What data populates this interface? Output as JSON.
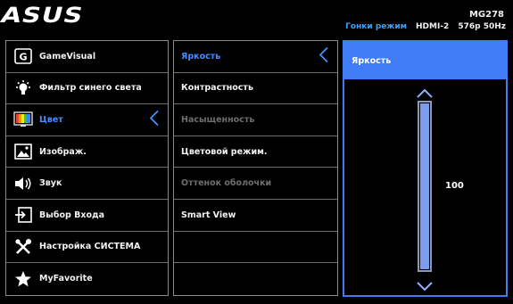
{
  "header": {
    "logo": "ASUS",
    "model": "MG278",
    "mode": "Гонки режим",
    "input": "HDMI-2",
    "resolution": "576p 50Hz"
  },
  "main_menu": [
    {
      "label": "GameVisual",
      "icon": "gamevisual-icon"
    },
    {
      "label": "Фильтр синего света",
      "icon": "bulb-icon"
    },
    {
      "label": "Цвет",
      "icon": "color-palette-icon",
      "active": true
    },
    {
      "label": "Изображ.",
      "icon": "image-icon"
    },
    {
      "label": "Звук",
      "icon": "speaker-icon"
    },
    {
      "label": "Выбор Входа",
      "icon": "input-select-icon"
    },
    {
      "label": "Настройка СИСТЕМА",
      "icon": "tools-icon"
    },
    {
      "label": "MyFavorite",
      "icon": "star-icon"
    }
  ],
  "sub_menu": [
    {
      "label": "Яркость",
      "state": "active"
    },
    {
      "label": "Контрастность",
      "state": "normal"
    },
    {
      "label": "Насыщенность",
      "state": "disabled"
    },
    {
      "label": "Цветовой режим.",
      "state": "normal"
    },
    {
      "label": "Оттенок оболочки",
      "state": "disabled"
    },
    {
      "label": "Smart View",
      "state": "normal"
    },
    {
      "label": "",
      "state": "empty"
    },
    {
      "label": "",
      "state": "empty"
    }
  ],
  "slider": {
    "title": "Яркость",
    "value": "100",
    "level_percent": 100
  },
  "colors": {
    "accent": "#3f7cf6",
    "active_text": "#4a8dff",
    "status_mode": "#3aa0ff",
    "disabled_text": "#6e6e6e"
  }
}
